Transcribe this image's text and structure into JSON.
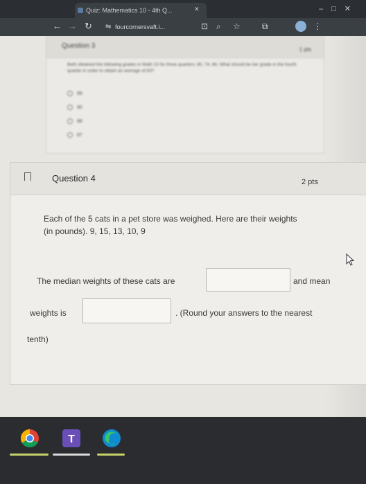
{
  "browser": {
    "tab_title": "Quiz: Mathematics 10 - 4th Q...",
    "address": "fourcornersvaft.i...",
    "nav_back": "←",
    "nav_forward": "→",
    "nav_reload": "↻"
  },
  "question3": {
    "title": "Question 3",
    "points": "1 pts",
    "text": "Beth obtained the following grades in Math 10 for three quarters: 80, 74, 86. What should be her grade in the fourth quarter in order to obtain an average of 83?",
    "options": [
      "89",
      "90",
      "88",
      "87"
    ]
  },
  "question4": {
    "title": "Question 4",
    "points": "2 pts",
    "line1": "Each of the 5 cats in a pet store was weighed. Here are their weights",
    "line2": "(in pounds). 9, 15, 13, 10, 9",
    "median_prefix": "The median weights of these cats are",
    "median_suffix": "and mean",
    "mean_prefix": "weights is",
    "mean_suffix": ". (Round your answers to the nearest",
    "line_end": "tenth)",
    "median_answer": "",
    "mean_answer": ""
  },
  "taskbar": {
    "apps": [
      "chrome-icon",
      "teams-icon",
      "edge-icon"
    ]
  },
  "colors": {
    "page_bg": "#e7e6e1",
    "taskbar_bg": "#2a2c2f",
    "chrome_underline": "#c9d36a"
  }
}
